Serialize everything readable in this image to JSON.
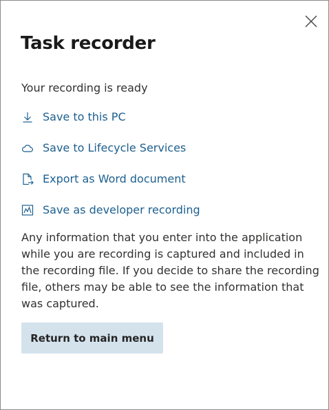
{
  "panel": {
    "title": "Task recorder",
    "status": "Your recording is ready",
    "close_icon": "close-icon"
  },
  "actions": [
    {
      "label": "Save to this PC",
      "icon": "download-icon"
    },
    {
      "label": "Save to Lifecycle Services",
      "icon": "cloud-icon"
    },
    {
      "label": "Export as Word document",
      "icon": "document-export-icon"
    },
    {
      "label": "Save as developer recording",
      "icon": "chart-icon"
    }
  ],
  "notice": "Any information that you enter into the application while you are recording is captured and included in the recording file. If you decide to share the recording file, others may be able to see the information that was captured.",
  "return_button": {
    "label": "Return to main menu"
  },
  "colors": {
    "link": "#1c5f8f",
    "button_bg": "#d4e2ec",
    "text": "#323130"
  }
}
